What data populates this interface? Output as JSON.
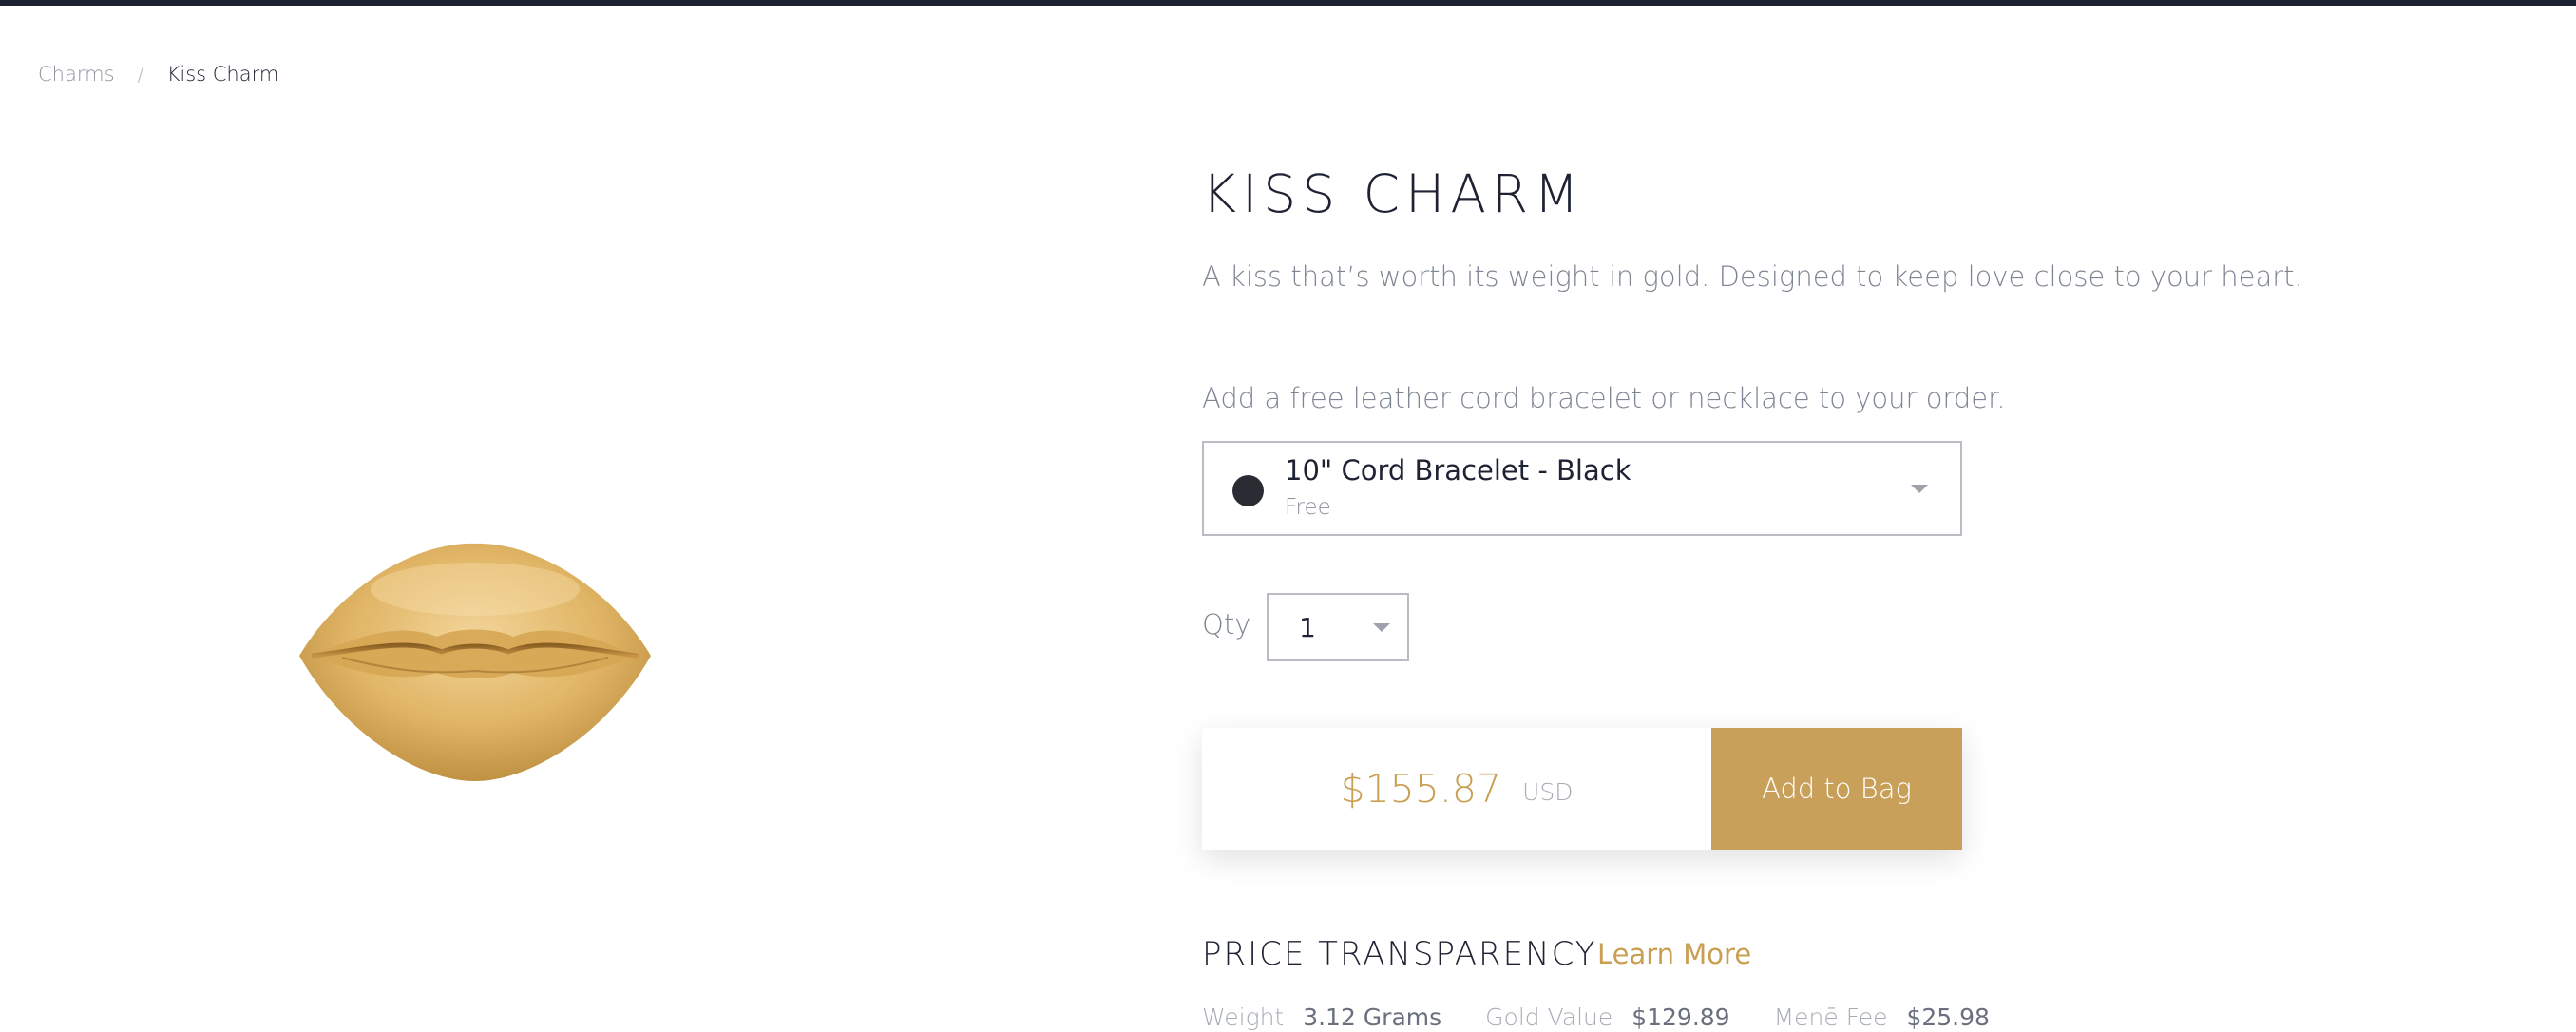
{
  "breadcrumb": {
    "parent": "Charms",
    "separator": "/",
    "current": "Kiss Charm"
  },
  "product": {
    "title": "KISS CHARM",
    "description": "A kiss that’s worth its weight in gold. Designed to keep love close to your heart.",
    "image_icon": "gold-lips-charm"
  },
  "cord_option": {
    "prompt": "Add a free leather cord bracelet or necklace to your order.",
    "selected_name": "10\" Cord Bracelet - Black",
    "selected_price": "Free",
    "swatch_color": "#2a2c33"
  },
  "quantity": {
    "label": "Qty",
    "value": "1"
  },
  "purchase": {
    "price": "$155.87",
    "currency": "USD",
    "button_label": "Add to Bag",
    "accent_color": "#c9a05a"
  },
  "transparency": {
    "heading": "PRICE TRANSPARENCY",
    "link_label": "Learn More",
    "specs": [
      {
        "label": "Weight",
        "value": "3.12 Grams"
      },
      {
        "label": "Gold Value",
        "value": "$129.89"
      },
      {
        "label": "Menē Fee",
        "value": "$25.98"
      }
    ]
  }
}
